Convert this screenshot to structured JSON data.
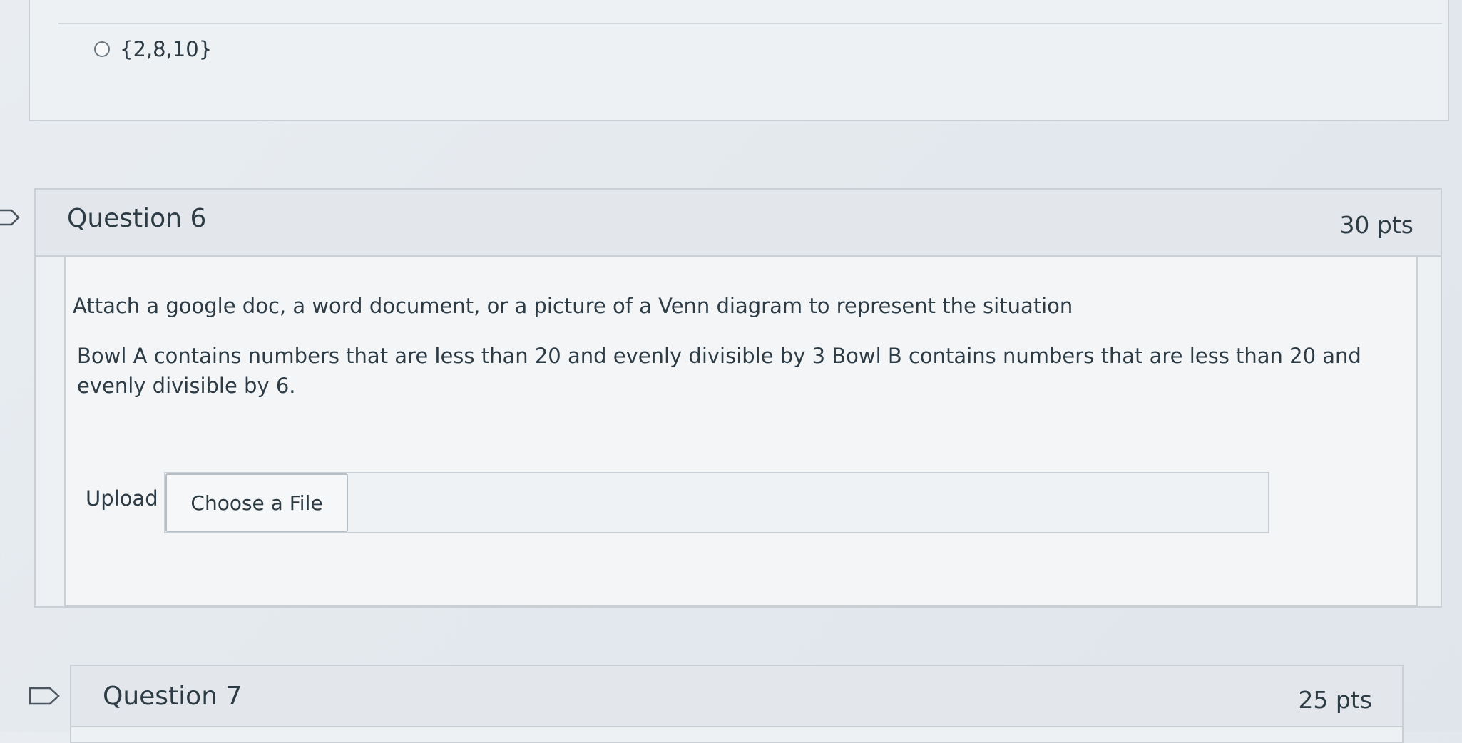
{
  "previous_question": {
    "option_label": "{2,8,10}"
  },
  "question6": {
    "title": "Question 6",
    "points": "30 pts",
    "prompt": "Attach a google doc, a word document, or a picture of a Venn diagram to represent the situation",
    "scenario": "Bowl A contains numbers that are less than 20 and evenly divisible by 3 Bowl B contains numbers that are less than 20 and evenly divisible by 6.",
    "upload_label": "Upload",
    "choose_file_label": "Choose a File"
  },
  "question7": {
    "title": "Question 7",
    "points": "25 pts"
  },
  "icons": {
    "flag": "flag-icon",
    "radio": "radio-button"
  },
  "colors": {
    "text": "#2d3b45",
    "border": "#c9cfd5",
    "background": "#e6eaee"
  }
}
